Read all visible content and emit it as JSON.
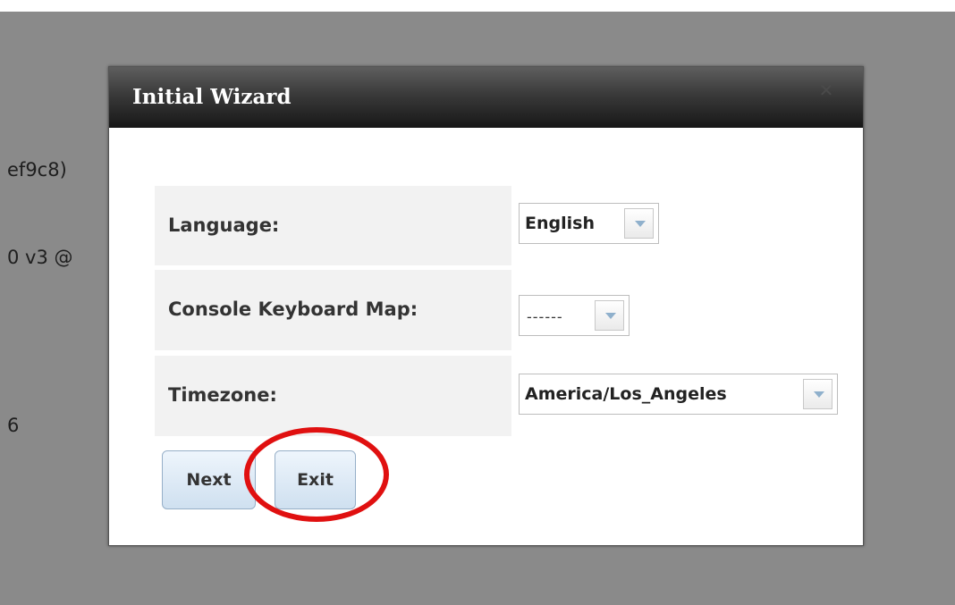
{
  "background": {
    "lines": [
      "ef9c8)",
      "0 v3 @",
      "6"
    ]
  },
  "dialog": {
    "title": "Initial Wizard",
    "close_glyph": "✕"
  },
  "form": {
    "language_label": "Language:",
    "language_value": "English",
    "keyboard_label": "Console Keyboard Map:",
    "keyboard_value": "------",
    "timezone_label": "Timezone:",
    "timezone_value": "America/Los_Angeles"
  },
  "buttons": {
    "next": "Next",
    "exit": "Exit"
  },
  "colors": {
    "overlay": "#8a8a8a",
    "titlebar": "#1a1a1a",
    "annotation": "#e01010",
    "button_border": "#96afc8"
  }
}
